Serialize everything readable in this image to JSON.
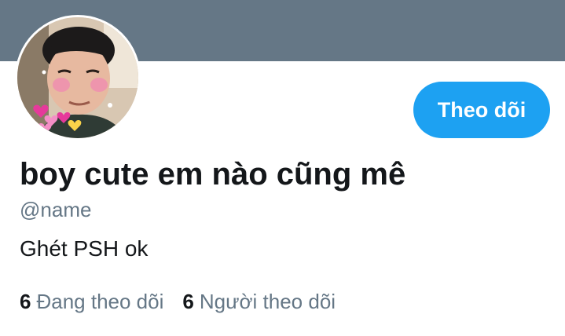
{
  "profile": {
    "display_name": "boy cute em nào cũng mê",
    "handle": "@name",
    "bio": "Ghét PSH ok"
  },
  "actions": {
    "follow_label": "Theo dõi"
  },
  "stats": {
    "following": {
      "count": "6",
      "label": "Đang theo dõi"
    },
    "followers": {
      "count": "6",
      "label": "Người theo dõi"
    }
  },
  "colors": {
    "banner": "#657786",
    "accent": "#1da1f2",
    "text_primary": "#14171a",
    "text_secondary": "#657786"
  }
}
